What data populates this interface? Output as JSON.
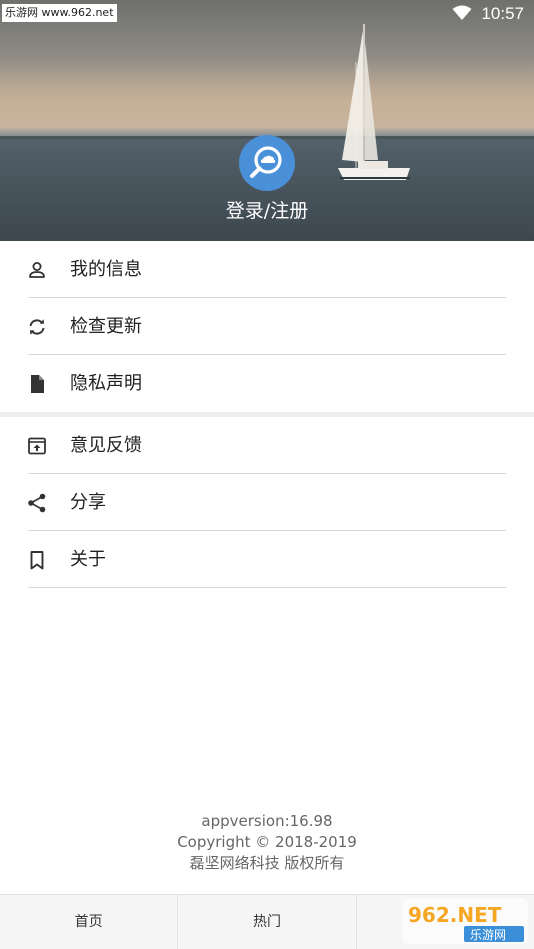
{
  "status_bar": {
    "watermark_text": "乐游网 www.962.net",
    "time": "10:57",
    "wifi_icon": "wifi-icon"
  },
  "header": {
    "avatar_icon": "cloud-search-icon",
    "avatar_color": "#4a90d9",
    "login_label": "登录/注册"
  },
  "menu": {
    "group1": [
      {
        "label": "我的信息",
        "icon": "person-icon"
      },
      {
        "label": "检查更新",
        "icon": "refresh-icon"
      },
      {
        "label": "隐私声明",
        "icon": "document-icon"
      }
    ],
    "group2": [
      {
        "label": "意见反馈",
        "icon": "feedback-upload-icon"
      },
      {
        "label": "分享",
        "icon": "share-icon"
      },
      {
        "label": "关于",
        "icon": "bookmark-icon"
      }
    ]
  },
  "footer": {
    "version": "appversion:16.98",
    "copyright": "Copyright © 2018-2019",
    "rights": "磊坚网络科技 版权所有"
  },
  "tabbar": {
    "tabs": [
      {
        "label": "首页"
      },
      {
        "label": "热门"
      },
      {
        "label": ""
      }
    ]
  },
  "watermark_logo": {
    "text_top": "962.NET",
    "text_bottom": "乐游网",
    "accent": "#f5a623"
  }
}
